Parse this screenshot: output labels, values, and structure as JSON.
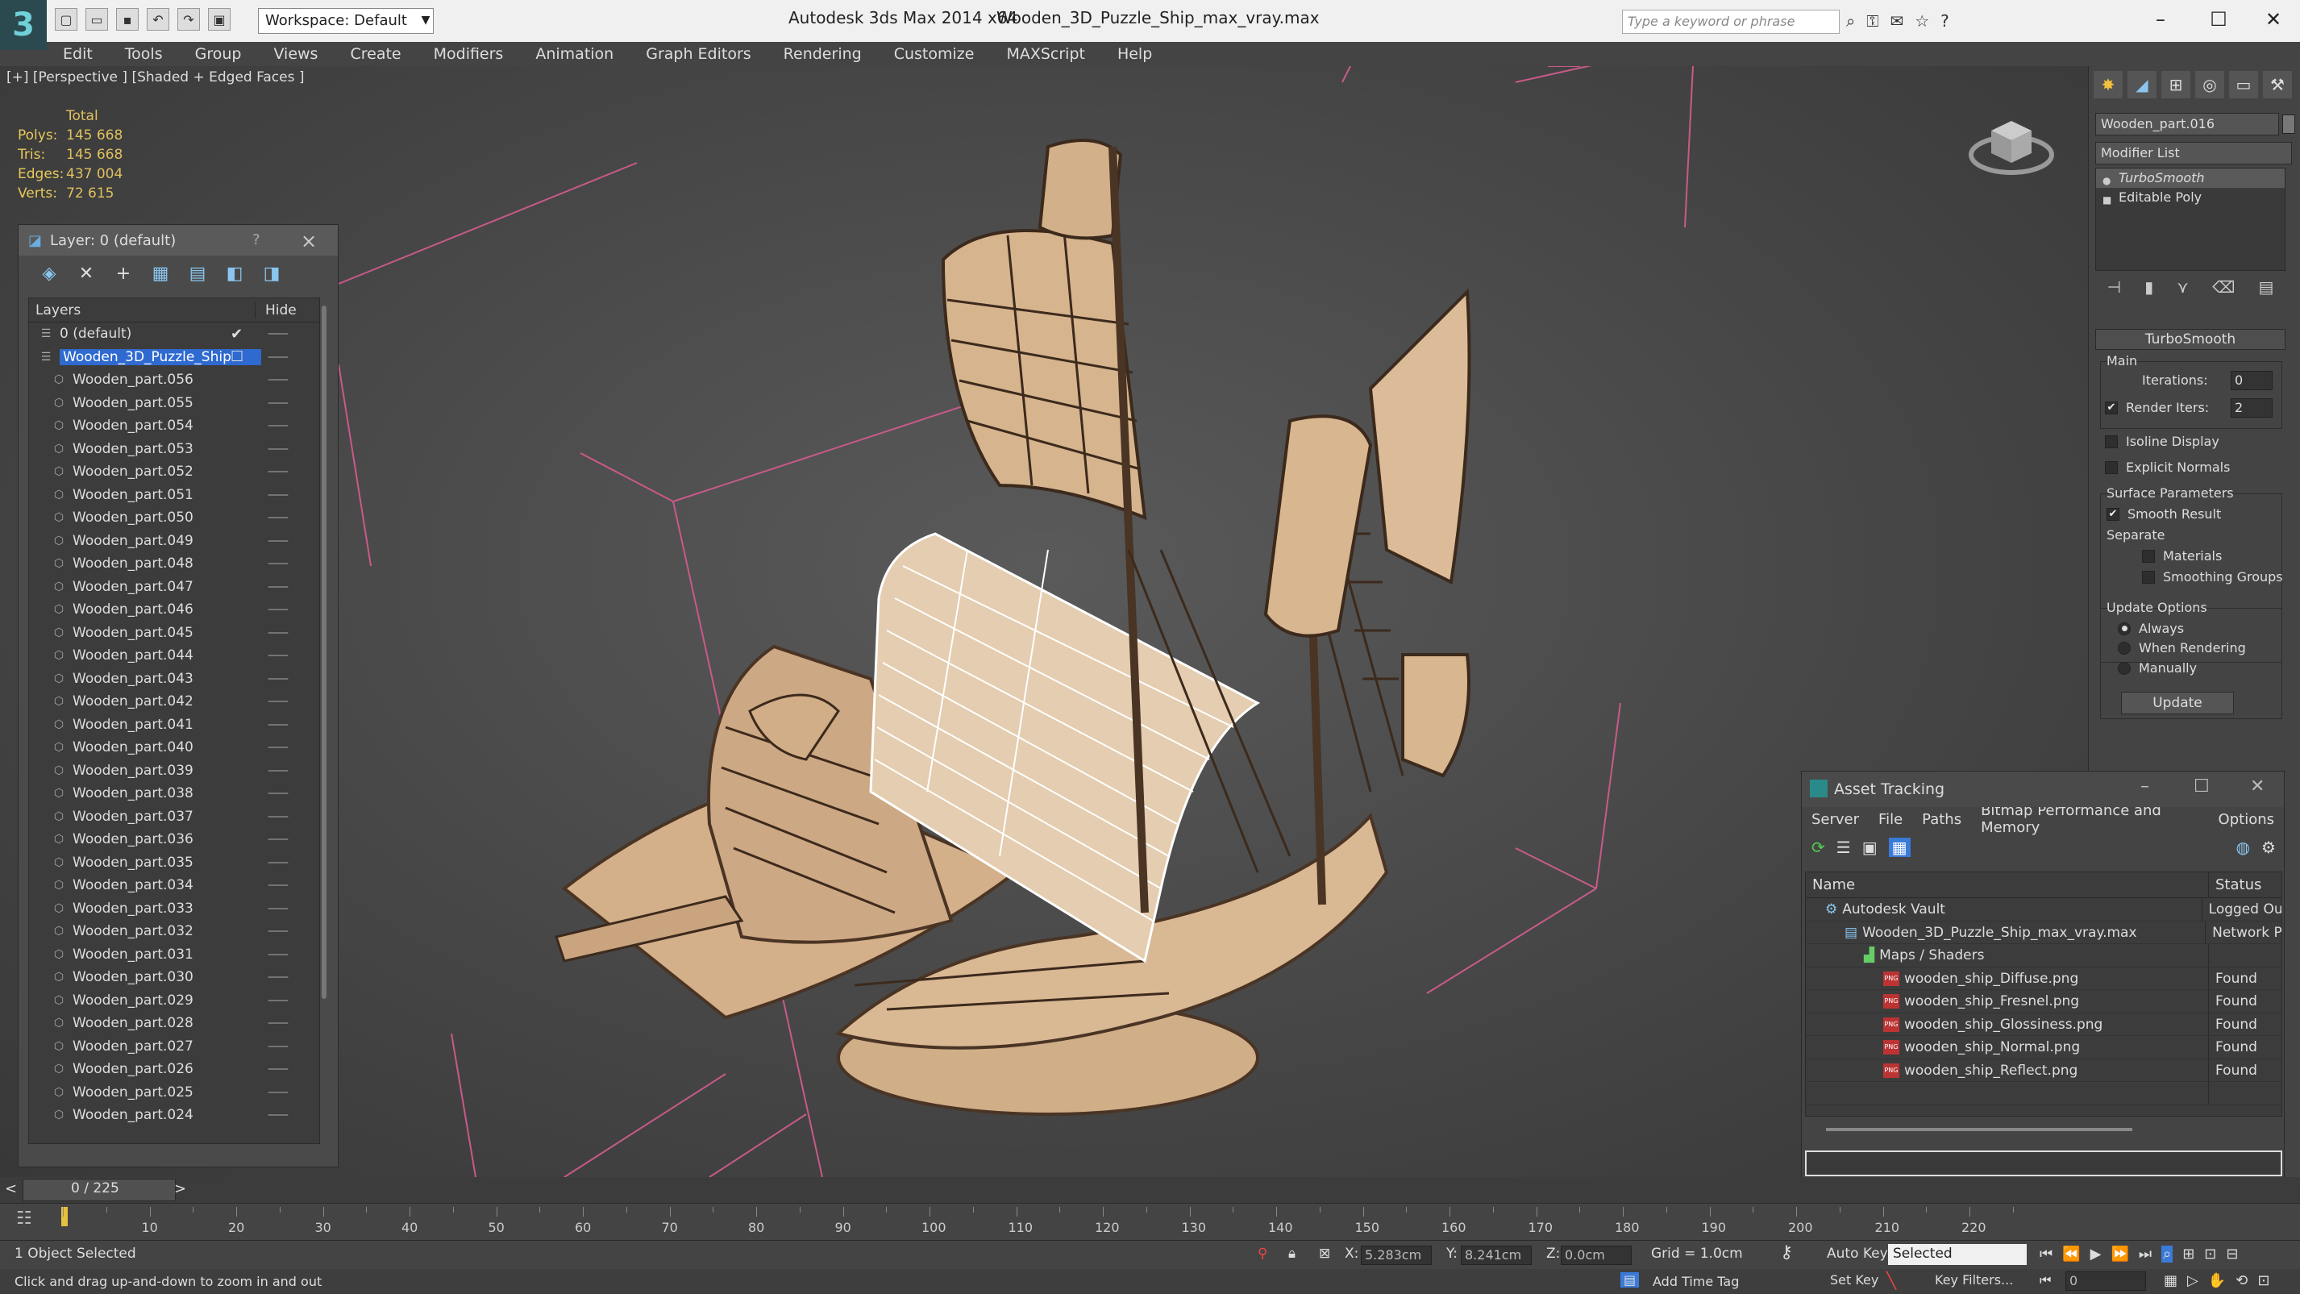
{
  "titlebar": {
    "workspace": "Workspace: Default",
    "app_title": "Autodesk 3ds Max  2014 x64",
    "file_title": "Wooden_3D_Puzzle_Ship_max_vray.max",
    "search_placeholder": "Type a keyword or phrase"
  },
  "menu": [
    "Edit",
    "Tools",
    "Group",
    "Views",
    "Create",
    "Modifiers",
    "Animation",
    "Graph Editors",
    "Rendering",
    "Customize",
    "MAXScript",
    "Help"
  ],
  "viewport": {
    "label": "[+] [Perspective ] [Shaded + Edged Faces ]",
    "stats": {
      "header": "Total",
      "polys_label": "Polys:",
      "polys": "145 668",
      "tris_label": "Tris:",
      "tris": "145 668",
      "edges_label": "Edges:",
      "edges": "437 004",
      "verts_label": "Verts:",
      "verts": "72 615"
    }
  },
  "layer_panel": {
    "title": "Layer: 0 (default)",
    "help": "?",
    "col_layers": "Layers",
    "col_hide": "Hide",
    "rows": [
      {
        "name": "0 (default)",
        "level": 1,
        "checked": true
      },
      {
        "name": "Wooden_3D_Puzzle_Ship",
        "level": 1,
        "selected": true
      },
      {
        "name": "Wooden_part.056",
        "level": 2
      },
      {
        "name": "Wooden_part.055",
        "level": 2
      },
      {
        "name": "Wooden_part.054",
        "level": 2
      },
      {
        "name": "Wooden_part.053",
        "level": 2
      },
      {
        "name": "Wooden_part.052",
        "level": 2
      },
      {
        "name": "Wooden_part.051",
        "level": 2
      },
      {
        "name": "Wooden_part.050",
        "level": 2
      },
      {
        "name": "Wooden_part.049",
        "level": 2
      },
      {
        "name": "Wooden_part.048",
        "level": 2
      },
      {
        "name": "Wooden_part.047",
        "level": 2
      },
      {
        "name": "Wooden_part.046",
        "level": 2
      },
      {
        "name": "Wooden_part.045",
        "level": 2
      },
      {
        "name": "Wooden_part.044",
        "level": 2
      },
      {
        "name": "Wooden_part.043",
        "level": 2
      },
      {
        "name": "Wooden_part.042",
        "level": 2
      },
      {
        "name": "Wooden_part.041",
        "level": 2
      },
      {
        "name": "Wooden_part.040",
        "level": 2
      },
      {
        "name": "Wooden_part.039",
        "level": 2
      },
      {
        "name": "Wooden_part.038",
        "level": 2
      },
      {
        "name": "Wooden_part.037",
        "level": 2
      },
      {
        "name": "Wooden_part.036",
        "level": 2
      },
      {
        "name": "Wooden_part.035",
        "level": 2
      },
      {
        "name": "Wooden_part.034",
        "level": 2
      },
      {
        "name": "Wooden_part.033",
        "level": 2
      },
      {
        "name": "Wooden_part.032",
        "level": 2
      },
      {
        "name": "Wooden_part.031",
        "level": 2
      },
      {
        "name": "Wooden_part.030",
        "level": 2
      },
      {
        "name": "Wooden_part.029",
        "level": 2
      },
      {
        "name": "Wooden_part.028",
        "level": 2
      },
      {
        "name": "Wooden_part.027",
        "level": 2
      },
      {
        "name": "Wooden_part.026",
        "level": 2
      },
      {
        "name": "Wooden_part.025",
        "level": 2
      },
      {
        "name": "Wooden_part.024",
        "level": 2
      }
    ]
  },
  "command_panel": {
    "object_name": "Wooden_part.016",
    "modifier_list": "Modifier List",
    "stack": [
      "TurboSmooth",
      "Editable Poly"
    ],
    "rollout_title": "TurboSmooth",
    "main_label": "Main",
    "iterations_label": "Iterations:",
    "iterations": "0",
    "render_iters_label": "Render Iters:",
    "render_iters": "2",
    "isoline": "Isoline Display",
    "explicit_normals": "Explicit Normals",
    "surface_params": "Surface Parameters",
    "smooth_result": "Smooth Result",
    "separate": "Separate",
    "materials": "Materials",
    "smoothing_groups": "Smoothing Groups",
    "update_options": "Update Options",
    "always": "Always",
    "when_rendering": "When Rendering",
    "manually": "Manually",
    "update_btn": "Update"
  },
  "asset_tracking": {
    "title": "Asset Tracking",
    "menu": [
      "Server",
      "File",
      "Paths",
      "Bitmap Performance and Memory",
      "Options"
    ],
    "col_name": "Name",
    "col_status": "Status",
    "rows": [
      {
        "name": "Autodesk Vault",
        "status": "Logged Ou",
        "indent": 1
      },
      {
        "name": "Wooden_3D_Puzzle_Ship_max_vray.max",
        "status": "Network P",
        "indent": 2
      },
      {
        "name": "Maps / Shaders",
        "status": "",
        "indent": 3
      },
      {
        "name": "wooden_ship_Diffuse.png",
        "status": "Found",
        "indent": 4,
        "png": true
      },
      {
        "name": "wooden_ship_Fresnel.png",
        "status": "Found",
        "indent": 4,
        "png": true
      },
      {
        "name": "wooden_ship_Glossiness.png",
        "status": "Found",
        "indent": 4,
        "png": true
      },
      {
        "name": "wooden_ship_Normal.png",
        "status": "Found",
        "indent": 4,
        "png": true
      },
      {
        "name": "wooden_ship_Reflect.png",
        "status": "Found",
        "indent": 4,
        "png": true
      }
    ],
    "png_label": "PNG"
  },
  "timeline": {
    "frame_label": "0 / 225",
    "ticks": [
      "10",
      "20",
      "30",
      "40",
      "50",
      "60",
      "70",
      "80",
      "90",
      "100",
      "110",
      "120",
      "130",
      "140",
      "150",
      "160",
      "170",
      "180",
      "190",
      "200",
      "210",
      "220"
    ]
  },
  "status": {
    "selected_count": "1 Object Selected",
    "prompt": "Click and drag up-and-down to zoom in and out",
    "x_label": "X:",
    "x_val": "5.283cm",
    "y_label": "Y:",
    "y_val": "8.241cm",
    "z_label": "Z:",
    "z_val": "0.0cm",
    "grid": "Grid = 1.0cm",
    "auto_key": "Auto Key",
    "selected_drop": "Selected",
    "set_key": "Set Key",
    "key_filters": "Key Filters...",
    "add_time_tag": "Add Time Tag",
    "frame_field": "0"
  },
  "colors": {
    "wood": "#d9b894",
    "wood_dark": "#5a3e2a",
    "wire_pink": "#c85a8a",
    "selection_blue": "#2e6ad0"
  }
}
